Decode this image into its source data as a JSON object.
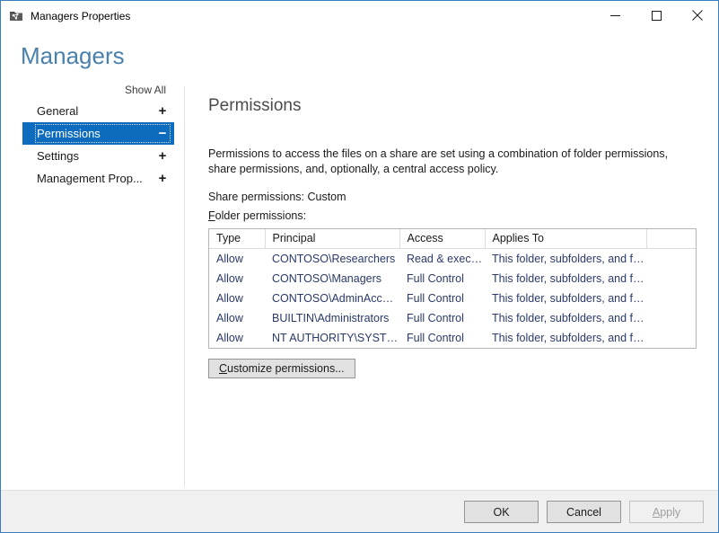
{
  "window": {
    "title": "Managers Properties",
    "icon": "shared-folder-icon",
    "accent_color": "#3a7fbb",
    "controls": {
      "minimize": "minimize-icon",
      "maximize": "maximize-icon",
      "close": "close-icon"
    }
  },
  "header": {
    "title": "Managers",
    "title_color": "#4a80ac"
  },
  "sidebar": {
    "show_all": "Show All",
    "items": [
      {
        "label": "General",
        "sign": "+",
        "selected": false
      },
      {
        "label": "Permissions",
        "sign": "−",
        "selected": true
      },
      {
        "label": "Settings",
        "sign": "+",
        "selected": false
      },
      {
        "label": "Management Prop...",
        "sign": "+",
        "selected": false
      }
    ],
    "selection_color": "#0d6cbd"
  },
  "main": {
    "panel_title": "Permissions",
    "description": "Permissions to access the files on a share are set using a combination of folder permissions, share permissions, and, optionally, a central access policy.",
    "share_permissions_label": "Share permissions:",
    "share_permissions_value": "Custom",
    "folder_permissions_accel": "F",
    "folder_permissions_label": "older permissions:",
    "customize_button_accel": "C",
    "customize_button_label": "ustomize permissions...",
    "table": {
      "columns": [
        "Type",
        "Principal",
        "Access",
        "Applies To",
        ""
      ],
      "rows": [
        [
          "Allow",
          "CONTOSO\\Researchers",
          "Read & execu...",
          "This folder, subfolders, and files",
          ""
        ],
        [
          "Allow",
          "CONTOSO\\Managers",
          "Full Control",
          "This folder, subfolders, and files",
          ""
        ],
        [
          "Allow",
          "CONTOSO\\AdminAccount",
          "Full Control",
          "This folder, subfolders, and files",
          ""
        ],
        [
          "Allow",
          "BUILTIN\\Administrators",
          "Full Control",
          "This folder, subfolders, and files",
          ""
        ],
        [
          "Allow",
          "NT AUTHORITY\\SYSTEM",
          "Full Control",
          "This folder, subfolders, and files",
          ""
        ]
      ]
    }
  },
  "footer": {
    "ok_label": "OK",
    "cancel_label": "Cancel",
    "apply_accel": "A",
    "apply_label": "pply",
    "apply_disabled": true
  }
}
